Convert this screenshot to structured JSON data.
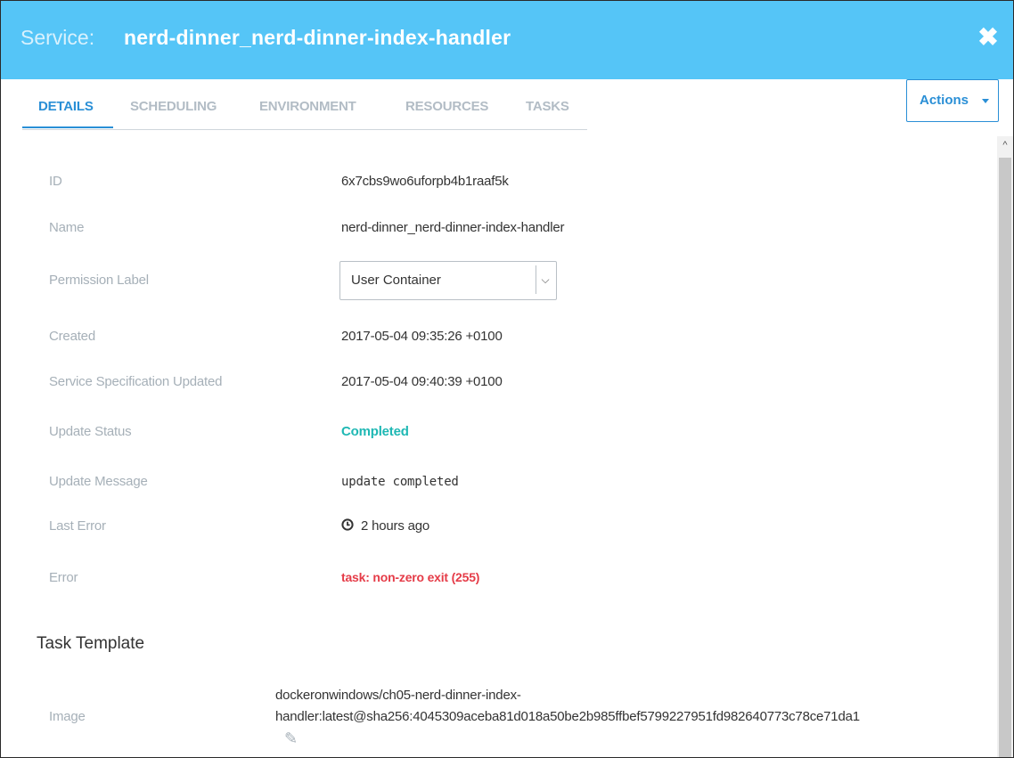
{
  "header": {
    "prefix": "Service:",
    "title": "nerd-dinner_nerd-dinner-index-handler",
    "close_icon": "close-icon"
  },
  "tabs": [
    {
      "label": "DETAILS",
      "active": true
    },
    {
      "label": "SCHEDULING",
      "active": false
    },
    {
      "label": "ENVIRONMENT",
      "active": false
    },
    {
      "label": "RESOURCES",
      "active": false
    },
    {
      "label": "TASKS",
      "active": false
    }
  ],
  "actions": {
    "label": "Actions"
  },
  "details": {
    "id": {
      "label": "ID",
      "value": "6x7cbs9wo6uforpb4b1raaf5k"
    },
    "name": {
      "label": "Name",
      "value": "nerd-dinner_nerd-dinner-index-handler"
    },
    "permission": {
      "label": "Permission Label",
      "value": "User Container"
    },
    "created": {
      "label": "Created",
      "value": "2017-05-04 09:35:26 +0100"
    },
    "spec_updated": {
      "label": "Service Specification Updated",
      "value": "2017-05-04 09:40:39 +0100"
    },
    "update_status": {
      "label": "Update Status",
      "value": "Completed"
    },
    "update_message": {
      "label": "Update Message",
      "value": "update completed"
    },
    "last_error": {
      "label": "Last Error",
      "value": "2 hours ago"
    },
    "error": {
      "label": "Error",
      "value": "task: non-zero exit (255)"
    }
  },
  "task_template": {
    "title": "Task Template",
    "image": {
      "label": "Image",
      "value_line1": "dockeronwindows/ch05-nerd-dinner-index-",
      "value_line2": "handler:latest@sha256:4045309aceba81d018a50be2b985ffbef5799227951fd982640773c78ce71da1"
    }
  },
  "colors": {
    "header_bg": "#55c5f7",
    "accent": "#2a8fd6",
    "success": "#1fb8b4",
    "error": "#e53c48"
  }
}
